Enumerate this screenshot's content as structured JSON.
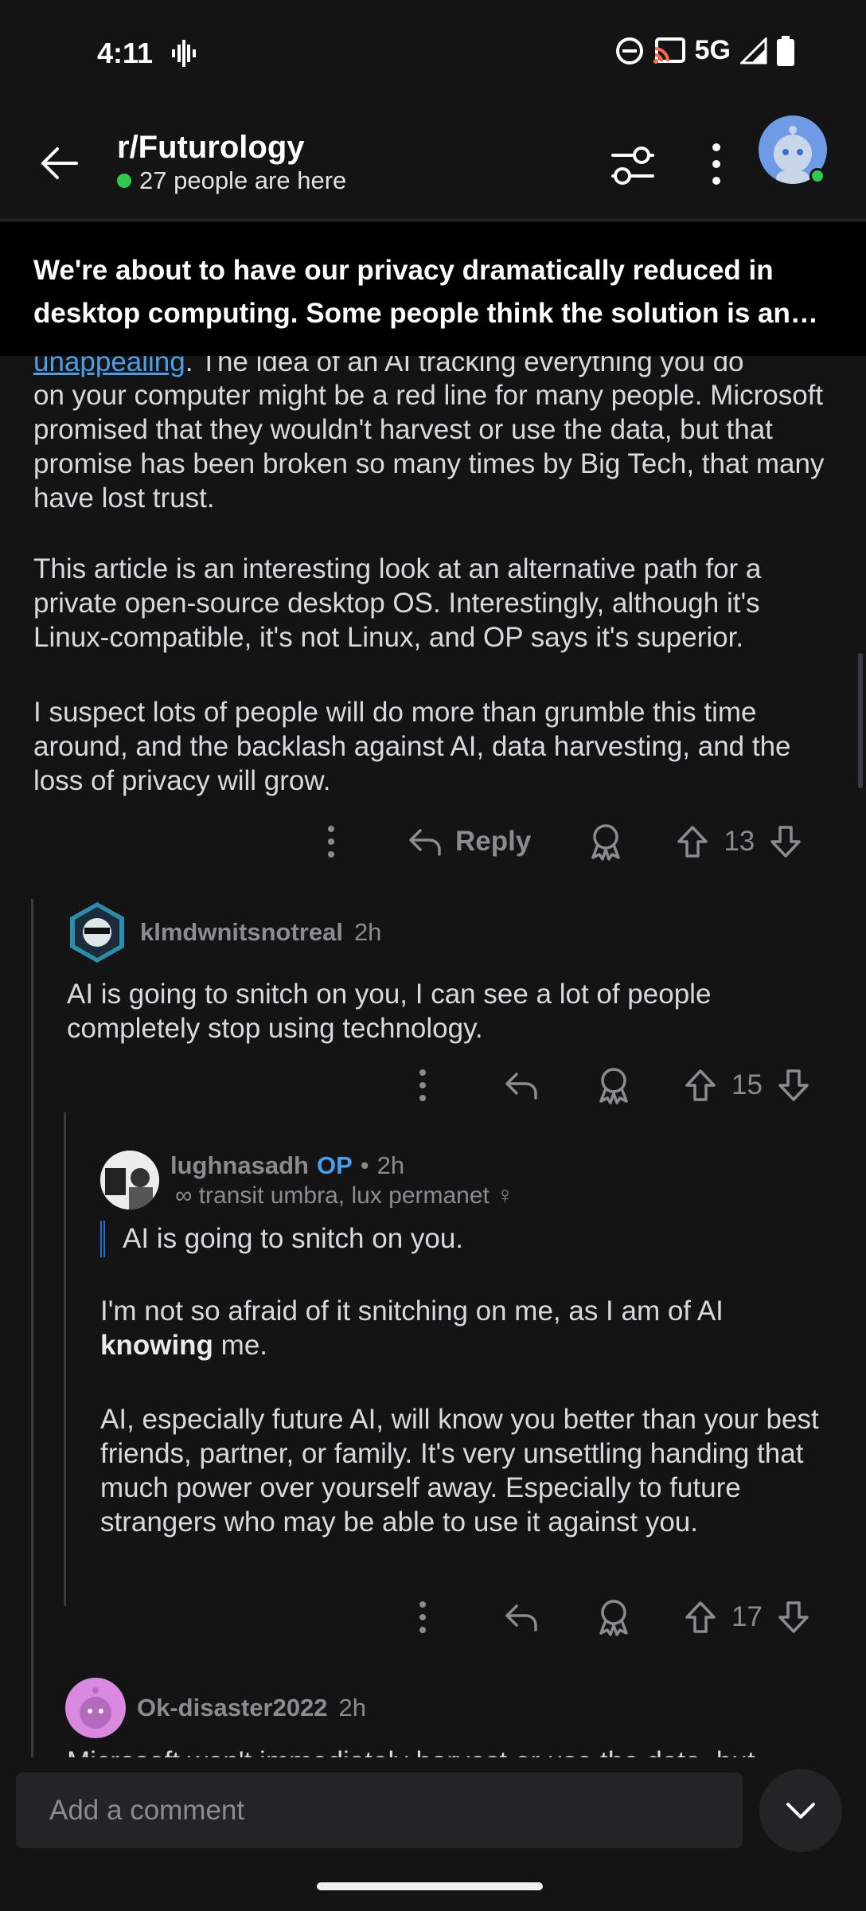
{
  "status_bar": {
    "time": "4:11",
    "network": "5G"
  },
  "header": {
    "subreddit": "r/Futurology",
    "presence": "27 people are here"
  },
  "post": {
    "title": "We're about to have our privacy dramatically reduced in desktop computing. Some people think the solution is an op...",
    "body_link_fragment": "unappealing",
    "body_line1_rest": ". The idea of an AI tracking everything you do",
    "body_p1": "on your computer might be a red line for many people. Microsoft promised that they wouldn't harvest or use the data, but that promise has been broken so many times by Big Tech, that many have lost trust.",
    "body_p2": "This article is an interesting look at an alternative path for a private open-source desktop OS. Interestingly, although it's Linux-compatible, it's not Linux, and OP says it's superior.",
    "body_p3": "I suspect lots of people will do more than grumble this time around, and the backlash against AI, data harvesting, and the loss of privacy will grow.",
    "reply_label": "Reply",
    "score": "13"
  },
  "comments": [
    {
      "user": "klmdwnitsnotreal",
      "time": "2h",
      "text": "AI is going to snitch on you, I can see a lot of people completely stop using technology.",
      "score": "15"
    },
    {
      "user": "lughnasadh",
      "op_badge": "OP",
      "sep": "•",
      "time": "2h",
      "flair": "∞ transit umbra, lux permanet ♀",
      "quote": "AI is going to snitch on you.",
      "p1_pre": "I'm not so afraid of it snitching on me, as I am of AI ",
      "p1_bold": "knowing",
      "p1_post": " me.",
      "p2": "AI, especially future AI, will know you better than your best friends, partner, or family. It's very unsettling handing that much power over yourself away. Especially to future strangers who may be able to use it against you.",
      "score": "17"
    },
    {
      "user": "Ok-disaster2022",
      "time": "2h",
      "text": "Microsoft won't immediately harvest or use the data, but"
    }
  ],
  "comment_bar": {
    "placeholder": "Add a comment"
  },
  "colors": {
    "background": "#141415",
    "link": "#4a9eea",
    "online": "#2ec94d",
    "muted": "#8a8c90"
  }
}
